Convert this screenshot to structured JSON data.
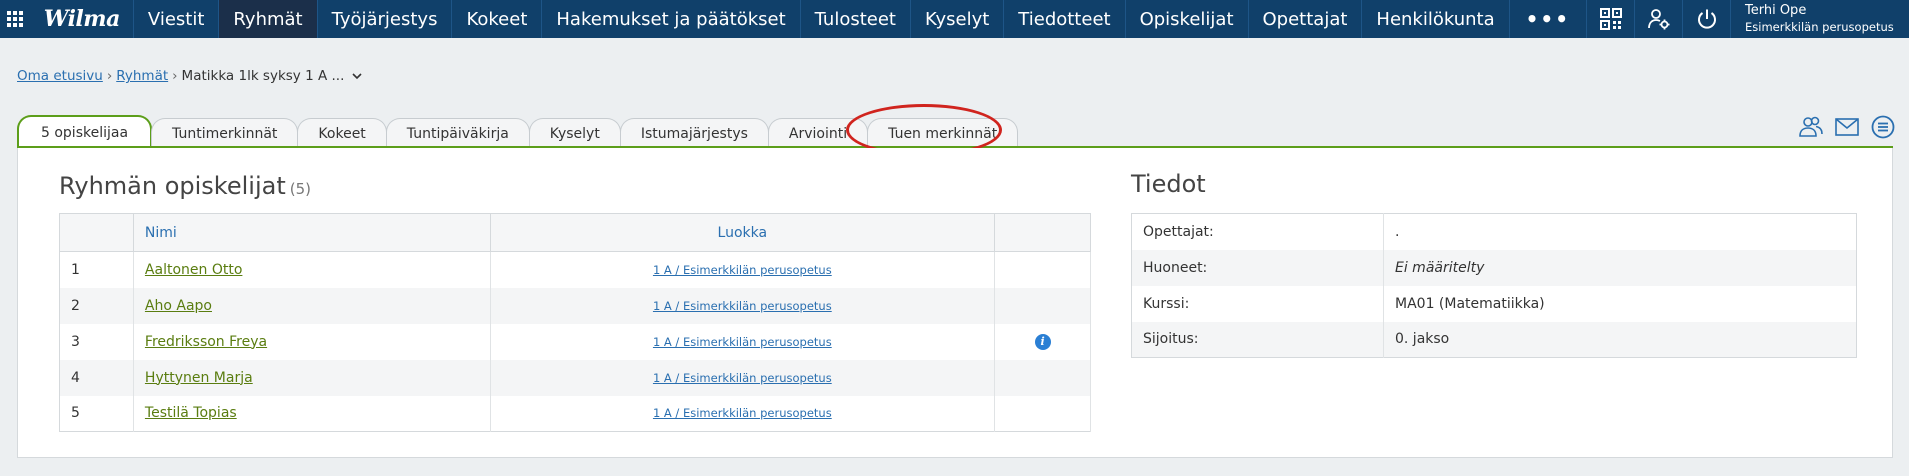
{
  "app": {
    "logo": "Wilma"
  },
  "nav": {
    "items": [
      {
        "label": "Viestit"
      },
      {
        "label": "Ryhmät",
        "active": true
      },
      {
        "label": "Työjärjestys"
      },
      {
        "label": "Kokeet"
      },
      {
        "label": "Hakemukset ja päätökset"
      },
      {
        "label": "Tulosteet"
      },
      {
        "label": "Kyselyt"
      },
      {
        "label": "Tiedotteet"
      },
      {
        "label": "Opiskelijat"
      },
      {
        "label": "Opettajat"
      },
      {
        "label": "Henkilökunta"
      }
    ],
    "more_label": "•••",
    "icons": [
      "qr-code-icon",
      "user-settings-icon",
      "power-icon"
    ],
    "user": {
      "name": "Terhi Ope",
      "school": "Esimerkkilän perusopetus"
    }
  },
  "breadcrumb": {
    "home": "Oma etusivu",
    "groups": "Ryhmät",
    "current": "Matikka 1lk syksy 1 A ...",
    "separator": "›"
  },
  "tabs": [
    {
      "label": "5 opiskelijaa",
      "active": true
    },
    {
      "label": "Tuntimerkinnät"
    },
    {
      "label": "Kokeet"
    },
    {
      "label": "Tuntipäiväkirja"
    },
    {
      "label": "Kyselyt"
    },
    {
      "label": "Istumajärjestys"
    },
    {
      "label": "Arviointi"
    },
    {
      "label": "Tuen merkinnät"
    }
  ],
  "tab_tools": [
    "group-users-icon",
    "mail-icon",
    "menu-list-icon"
  ],
  "colors": {
    "navbar": "#10406a",
    "accent_green": "#5c9e1a",
    "link_blue": "#2a6fb0",
    "highlight_red": "#d0241e"
  },
  "students": {
    "title": "Ryhmän opiskelijat",
    "count": "(5)",
    "columns": {
      "name": "Nimi",
      "class": "Luokka"
    },
    "rows": [
      {
        "num": "1",
        "name": "Aaltonen Otto",
        "class": "1 A / Esimerkkilän perusopetus",
        "info": false
      },
      {
        "num": "2",
        "name": "Aho Aapo",
        "class": "1 A / Esimerkkilän perusopetus",
        "info": false
      },
      {
        "num": "3",
        "name": "Fredriksson Freya",
        "class": "1 A / Esimerkkilän perusopetus",
        "info": true
      },
      {
        "num": "4",
        "name": "Hyttynen Marja",
        "class": "1 A / Esimerkkilän perusopetus",
        "info": false
      },
      {
        "num": "5",
        "name": "Testilä Topias",
        "class": "1 A / Esimerkkilän perusopetus",
        "info": false
      }
    ],
    "info_glyph": "i"
  },
  "details": {
    "title": "Tiedot",
    "rows": [
      {
        "key": "Opettajat:",
        "value": "."
      },
      {
        "key": "Huoneet:",
        "value": "Ei määritelty",
        "italic": true
      },
      {
        "key": "Kurssi:",
        "value": "MA01 (Matematiikka)"
      },
      {
        "key": "Sijoitus:",
        "value": "0. jakso"
      }
    ]
  }
}
